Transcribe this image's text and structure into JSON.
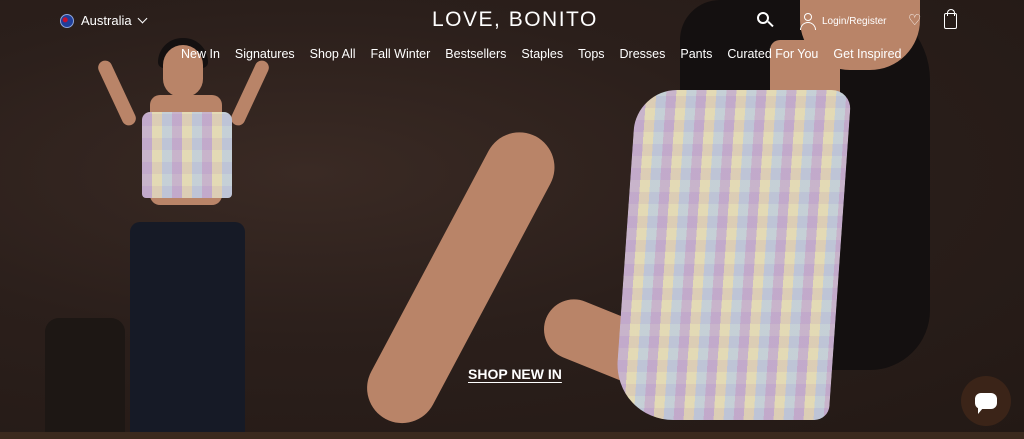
{
  "header": {
    "country": "Australia",
    "logo": "LOVE, BONITO",
    "login_label": "Login/Register"
  },
  "nav": {
    "items": [
      "New In",
      "Signatures",
      "Shop All",
      "Fall Winter",
      "Bestsellers",
      "Staples",
      "Tops",
      "Dresses",
      "Pants",
      "Curated For You",
      "Get Inspired"
    ]
  },
  "hero": {
    "cta": "SHOP NEW IN"
  },
  "icons": {
    "search": "search-icon",
    "user": "user-icon",
    "wishlist": "heart-icon",
    "bag": "shopping-bag-icon",
    "chat": "chat-icon",
    "flag": "australia-flag-icon"
  },
  "colors": {
    "background": "#2a1e1a",
    "chat_button": "#3b2418",
    "text": "#ffffff"
  }
}
